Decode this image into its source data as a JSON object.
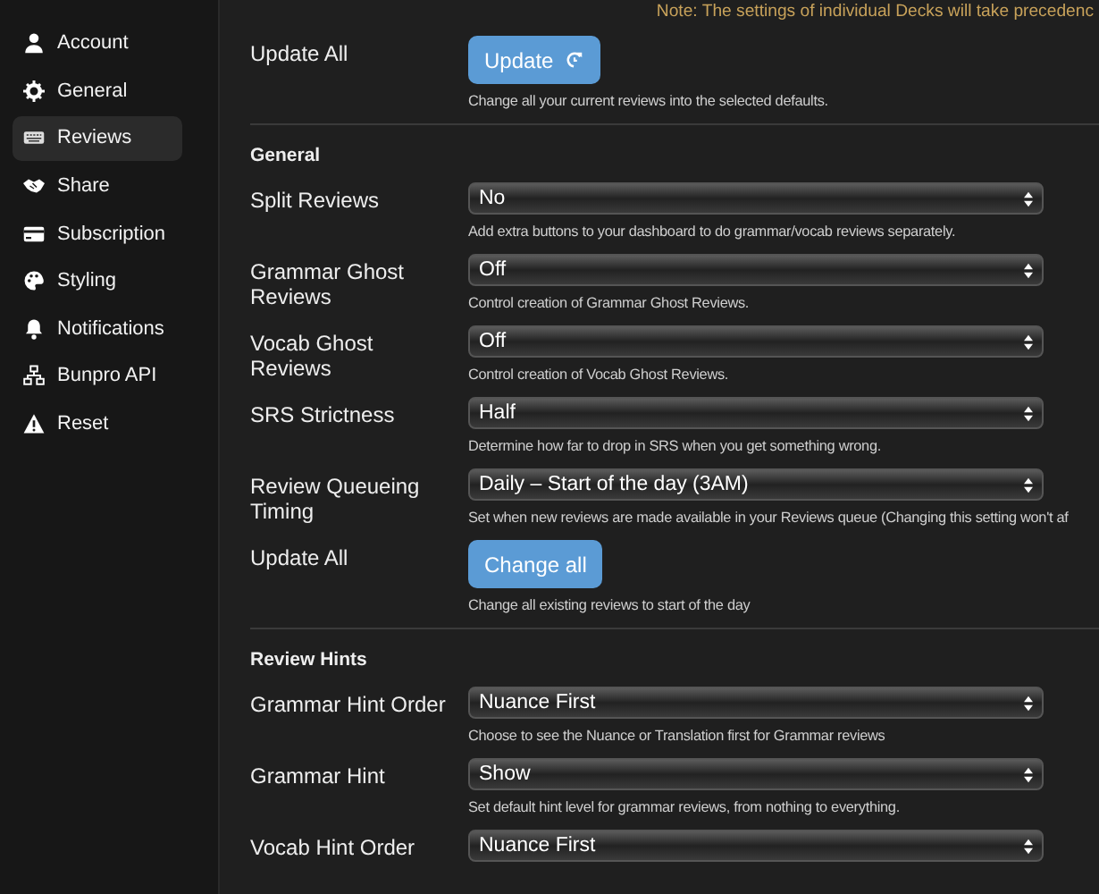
{
  "sidebar": {
    "items": [
      {
        "label": "Account",
        "selected": false
      },
      {
        "label": "General",
        "selected": false
      },
      {
        "label": "Reviews",
        "selected": true
      },
      {
        "label": "Share",
        "selected": false
      },
      {
        "label": "Subscription",
        "selected": false
      },
      {
        "label": "Styling",
        "selected": false
      },
      {
        "label": "Notifications",
        "selected": false
      },
      {
        "label": "Bunpro API",
        "selected": false
      },
      {
        "label": "Reset",
        "selected": false
      }
    ]
  },
  "note": "Note: The settings of individual Decks will take precedenc",
  "sections": [
    {
      "rows": [
        {
          "kind": "button",
          "label": "Update All",
          "button": "Update",
          "button_icon": true,
          "help": "Change all your current reviews into the selected defaults."
        }
      ]
    },
    {
      "title": "General",
      "rows": [
        {
          "kind": "select",
          "label": "Split Reviews",
          "value": "No",
          "help": "Add extra buttons to your dashboard to do grammar/vocab reviews separately."
        },
        {
          "kind": "select",
          "label": "Grammar Ghost Reviews",
          "value": "Off",
          "help": "Control creation of Grammar Ghost Reviews."
        },
        {
          "kind": "select",
          "label": "Vocab Ghost Reviews",
          "value": "Off",
          "help": "Control creation of Vocab Ghost Reviews."
        },
        {
          "kind": "select",
          "label": "SRS Strictness",
          "value": "Half",
          "help": "Determine how far to drop in SRS when you get something wrong."
        },
        {
          "kind": "select",
          "label": "Review Queueing Timing",
          "value": "Daily – Start of the day (3AM)",
          "help": "Set when new reviews are made available in your Reviews queue (Changing this setting won't af"
        },
        {
          "kind": "button",
          "label": "Update All",
          "button": "Change all",
          "button_icon": false,
          "help": "Change all existing reviews to start of the day"
        }
      ]
    },
    {
      "title": "Review Hints",
      "rows": [
        {
          "kind": "select",
          "label": "Grammar Hint Order",
          "value": "Nuance First",
          "help": "Choose to see the Nuance or Translation first for Grammar reviews"
        },
        {
          "kind": "select",
          "label": "Grammar Hint",
          "value": "Show",
          "help": "Set default hint level for grammar reviews, from nothing to everything."
        },
        {
          "kind": "select",
          "label": "Vocab Hint Order",
          "value": "Nuance First"
        }
      ]
    }
  ]
}
